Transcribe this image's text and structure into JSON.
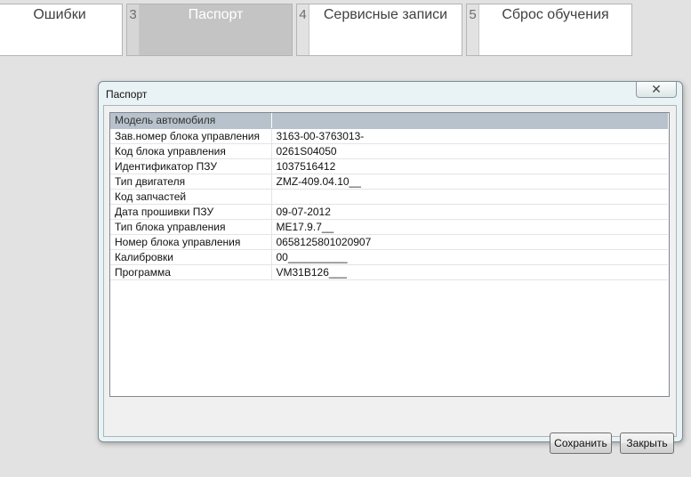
{
  "tabs": [
    {
      "number": "",
      "label": "Ошибки"
    },
    {
      "number": "3",
      "label": "Паспорт"
    },
    {
      "number": "4",
      "label": "Сервисные записи"
    },
    {
      "number": "5",
      "label": "Сброс обучения"
    }
  ],
  "dialog": {
    "title": "Паспорт",
    "close_glyph": "✕",
    "rows": [
      {
        "key": "Модель автомобиля",
        "value": ""
      },
      {
        "key": "Зав.номер блока управления",
        "value": "3163-00-3763013-"
      },
      {
        "key": "Код блока управления",
        "value": "0261S04050"
      },
      {
        "key": "Идентификатор ПЗУ",
        "value": "1037516412"
      },
      {
        "key": "Тип двигателя",
        "value": "ZMZ-409.04.10__"
      },
      {
        "key": "Код запчастей",
        "value": ""
      },
      {
        "key": "Дата прошивки ПЗУ",
        "value": "09-07-2012"
      },
      {
        "key": "Тип блока управления",
        "value": "ME17.9.7__"
      },
      {
        "key": "Номер блока управления",
        "value": "0658125801020907"
      },
      {
        "key": "Калибровки",
        "value": "00__________"
      },
      {
        "key": "Программа",
        "value": "VM31B126___"
      }
    ],
    "save_label": "Сохранить",
    "close_label": "Закрыть"
  }
}
